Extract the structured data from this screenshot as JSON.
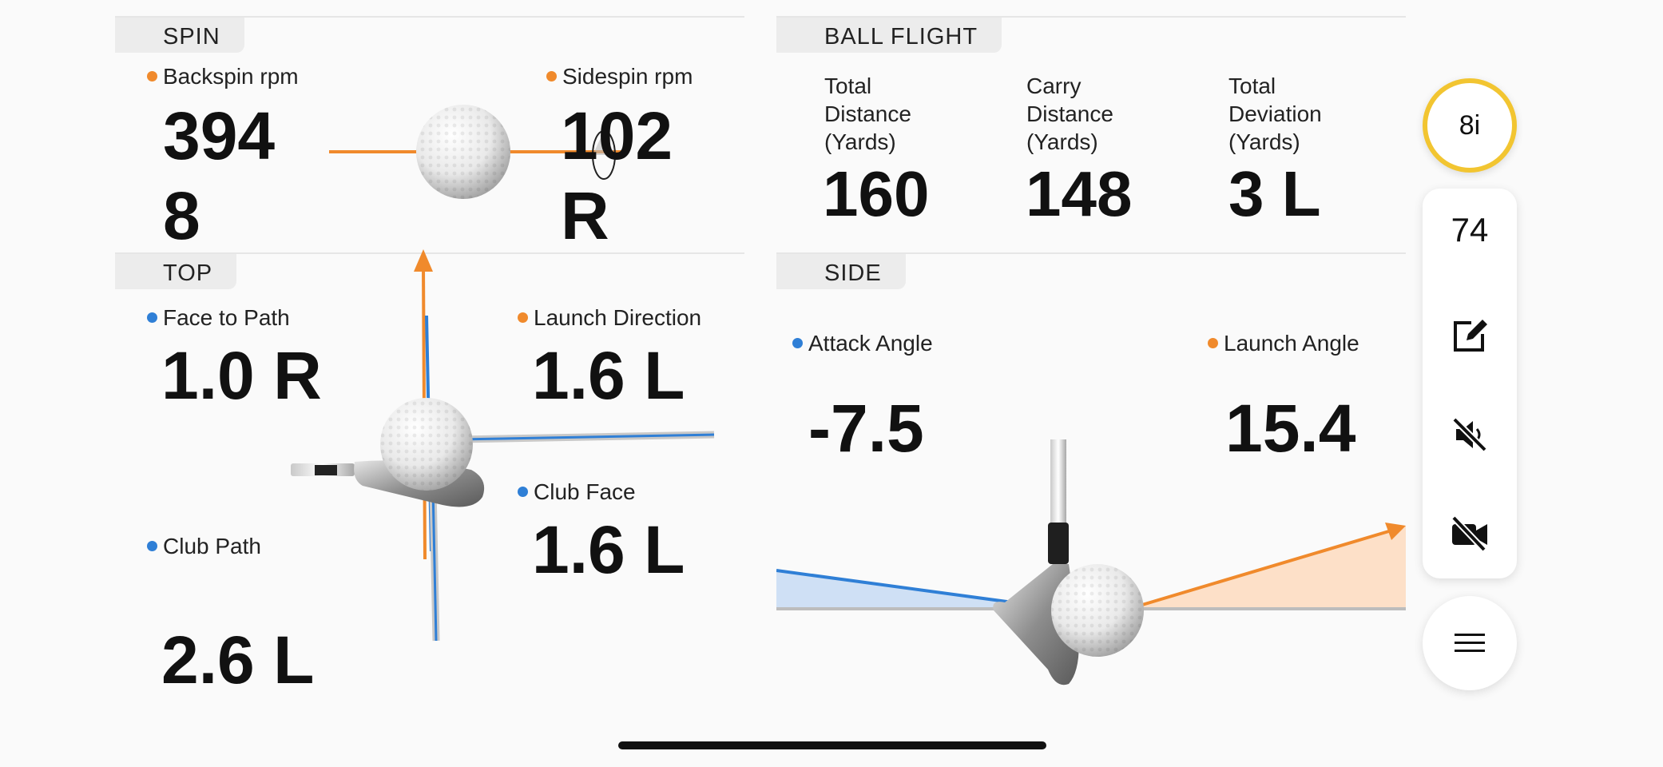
{
  "spin": {
    "tab": "SPIN",
    "backspin_label": "Backspin rpm",
    "backspin_line1": "394",
    "backspin_line2": "8",
    "sidespin_label": "Sidespin rpm",
    "sidespin_line1": "102",
    "sidespin_line2": "R"
  },
  "ball_flight": {
    "tab": "BALL FLIGHT",
    "items": [
      {
        "label_lines": [
          "Total",
          "Distance",
          "(Yards)"
        ],
        "value": "160"
      },
      {
        "label_lines": [
          "Carry",
          "Distance",
          "(Yards)"
        ],
        "value": "148"
      },
      {
        "label_lines": [
          "Total",
          "Deviation",
          "(Yards)"
        ],
        "value": "3 L"
      }
    ]
  },
  "top": {
    "tab": "TOP",
    "face_to_path_label": "Face to Path",
    "face_to_path_value": "1.0 R",
    "launch_direction_label": "Launch Direction",
    "launch_direction_value": "1.6 L",
    "club_face_label": "Club Face",
    "club_face_value": "1.6 L",
    "club_path_label": "Club Path",
    "club_path_value": "2.6 L"
  },
  "side": {
    "tab": "SIDE",
    "attack_angle_label": "Attack Angle",
    "attack_angle_value": "-7.5",
    "launch_angle_label": "Launch Angle",
    "launch_angle_value": "15.4"
  },
  "toolbar": {
    "club": "8i",
    "shot_count": "74",
    "icons": [
      "edit-note-icon",
      "mute-icon",
      "video-off-icon",
      "menu-icon"
    ]
  },
  "colors": {
    "orange": "#f08a2c",
    "blue": "#2f7fd6",
    "club_badge_ring": "#f2c531"
  }
}
